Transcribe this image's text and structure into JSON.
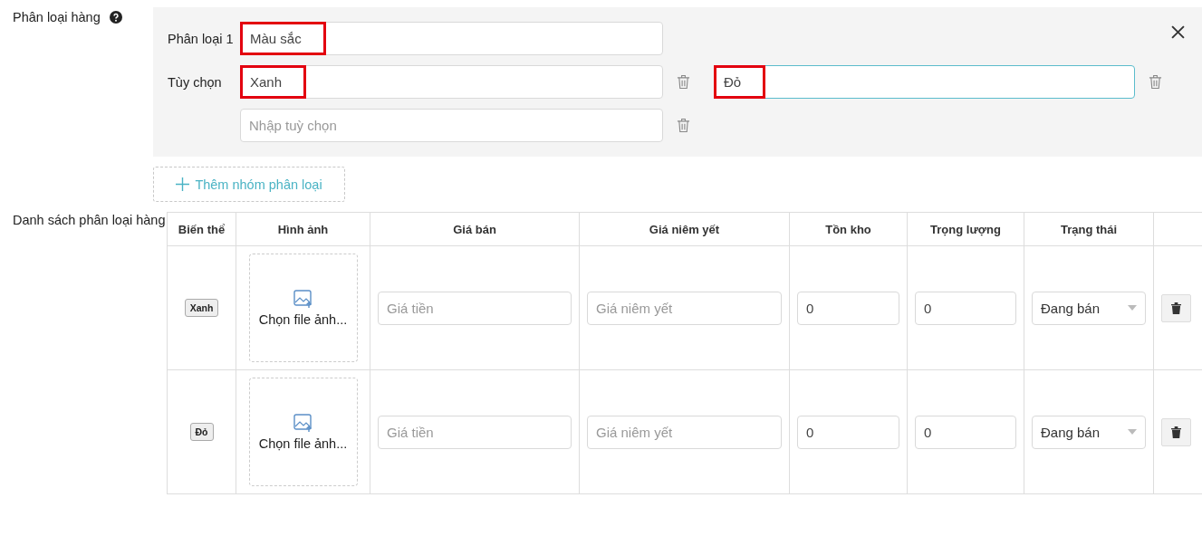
{
  "variation": {
    "label": "Phân loại hàng",
    "group": {
      "label": "Phân loại 1",
      "name": {
        "value": "Màu sắc",
        "highlighted": true
      },
      "options_label": "Tùy chọn",
      "options": [
        {
          "value": "Xanh",
          "highlighted": true,
          "focused": false
        },
        {
          "value": "Đỏ",
          "highlighted": true,
          "focused": true
        }
      ],
      "new_option": {
        "placeholder": "Nhập tuỳ chọn"
      }
    },
    "add_group": {
      "label": "Thêm nhóm phân loại"
    }
  },
  "variant_list": {
    "label": "Danh sách phân loại hàng",
    "columns": [
      "Biến thể",
      "Hình ảnh",
      "Giá bán",
      "Giá niêm yết",
      "Tồn kho",
      "Trọng lượng",
      "Trạng thái"
    ],
    "rows": [
      {
        "variant": "Xanh",
        "image": "Chọn file ảnh...",
        "price": {
          "placeholder": "Giá tiền"
        },
        "list_price": {
          "placeholder": "Giá niêm yết"
        },
        "stock": "0",
        "weight": "0",
        "status": "Đang bán"
      },
      {
        "variant": "Đỏ",
        "image": "Chọn file ảnh...",
        "price": {
          "placeholder": "Giá tiền"
        },
        "list_price": {
          "placeholder": "Giá niêm yết"
        },
        "stock": "0",
        "weight": "0",
        "status": "Đang bán"
      }
    ]
  }
}
